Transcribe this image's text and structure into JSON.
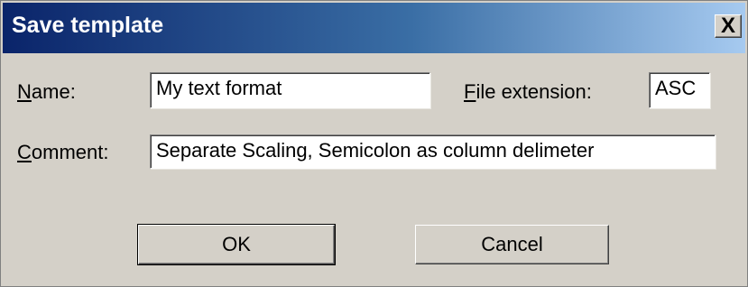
{
  "window": {
    "title": "Save template",
    "close_glyph": "X"
  },
  "form": {
    "name_label_accel": "N",
    "name_label_rest": "ame:",
    "name_value": "My text format",
    "ext_label_accel": "F",
    "ext_label_rest": "ile extension:",
    "ext_value": "ASC",
    "comment_label_accel": "C",
    "comment_label_rest": "omment:",
    "comment_value": "Separate Scaling, Semicolon as column delimeter"
  },
  "buttons": {
    "ok_label": "OK",
    "cancel_label": "Cancel"
  },
  "colors": {
    "dialog_bg": "#d4d0c8",
    "title_gradient_start": "#0a246a",
    "title_gradient_end": "#a6caf0"
  }
}
